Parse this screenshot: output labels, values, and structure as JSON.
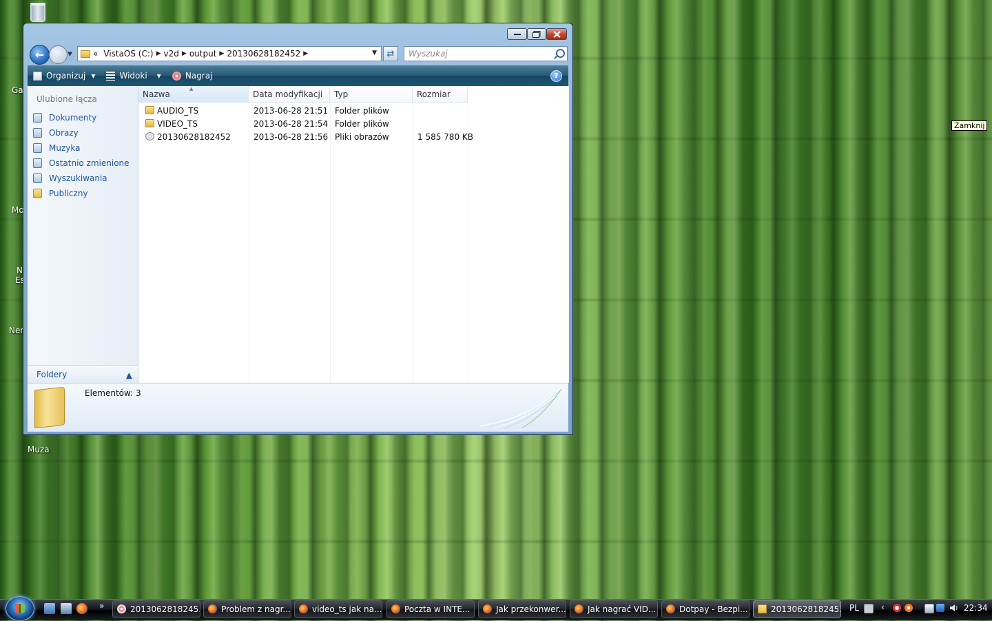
{
  "desktop": {
    "icons": [
      {
        "label": "Ga"
      },
      {
        "label": "Mo"
      },
      {
        "label": "N"
      },
      {
        "label": "Es"
      },
      {
        "label": "Ner"
      },
      {
        "label": "Muza"
      }
    ],
    "tooltip": "Zamknij"
  },
  "window": {
    "address": {
      "overflow": "«",
      "crumbs": [
        "VistaOS (C:)",
        "v2d",
        "output",
        "20130628182452"
      ]
    },
    "search_placeholder": "Wyszukaj",
    "toolbar": {
      "organize": "Organizuj",
      "views": "Widoki",
      "burn": "Nagraj",
      "help": "?"
    },
    "nav": {
      "title": "Ulubione łącza",
      "items": [
        "Dokumenty",
        "Obrazy",
        "Muzyka",
        "Ostatnio zmienione",
        "Wyszukiwania",
        "Publiczny"
      ],
      "folders_label": "Foldery"
    },
    "columns": [
      "Nazwa",
      "Data modyfikacji",
      "Typ",
      "Rozmiar"
    ],
    "files": [
      {
        "name": "AUDIO_TS",
        "date": "2013-06-28 21:51",
        "type": "Folder plików",
        "size": "",
        "icon": "folder-icon"
      },
      {
        "name": "VIDEO_TS",
        "date": "2013-06-28 21:54",
        "type": "Folder plików",
        "size": "",
        "icon": "folder-icon"
      },
      {
        "name": "20130628182452",
        "date": "2013-06-28 21:56",
        "type": "Pliki obrazów",
        "size": "1 585 780 KB",
        "icon": "disc-image-icon"
      }
    ],
    "details": {
      "count_text": "Elementów: 3"
    }
  },
  "taskbar": {
    "more": "»",
    "tasks": [
      {
        "label": "2013062818245...",
        "active": false
      },
      {
        "label": "Problem z nagr...",
        "active": false
      },
      {
        "label": "video_ts jak na...",
        "active": false
      },
      {
        "label": "Poczta w INTE...",
        "active": false
      },
      {
        "label": "Jak przekonwer...",
        "active": false
      },
      {
        "label": "Jak nagrać VID...",
        "active": false
      },
      {
        "label": "Dotpay - Bezpi...",
        "active": false
      },
      {
        "label": "20130628182452",
        "active": true
      }
    ],
    "language": "PL",
    "clock": "22:34"
  }
}
